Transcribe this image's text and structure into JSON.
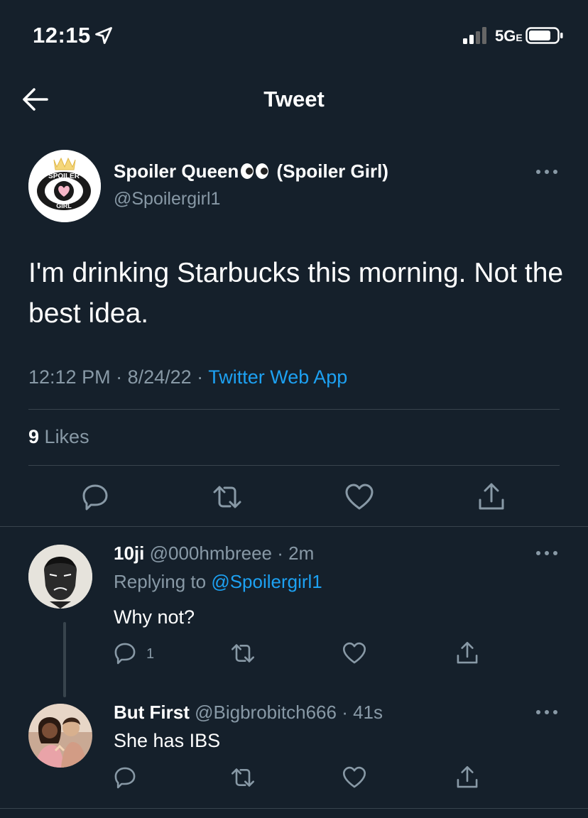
{
  "status_bar": {
    "time": "12:15",
    "network": "5G",
    "network_suffix": "E"
  },
  "header": {
    "title": "Tweet"
  },
  "tweet": {
    "author_name": "Spoiler Queen",
    "author_name_suffix": "(Spoiler Girl)",
    "author_handle": "@Spoilergirl1",
    "avatar_text_top": "SPOILER",
    "avatar_text_bottom": "GIRL",
    "text": "I'm drinking Starbucks this morning. Not the best idea.",
    "time": "12:12 PM",
    "date": "8/24/22",
    "source": "Twitter Web App",
    "likes_count": "9",
    "likes_label": "Likes"
  },
  "replies": [
    {
      "name": "10ji",
      "handle": "@000hmbreee",
      "age": "2m",
      "replying_prefix": "Replying to",
      "replying_to": "@Spoilergirl1",
      "text": "Why not?",
      "reply_count": "1"
    },
    {
      "name": "But First",
      "handle": "@Bigbrobitch666",
      "age": "41s",
      "text": "She has IBS"
    }
  ],
  "colors": {
    "background": "#15202b",
    "secondary_text": "#8899a6",
    "accent": "#1da1f2",
    "divider": "#38444d"
  }
}
